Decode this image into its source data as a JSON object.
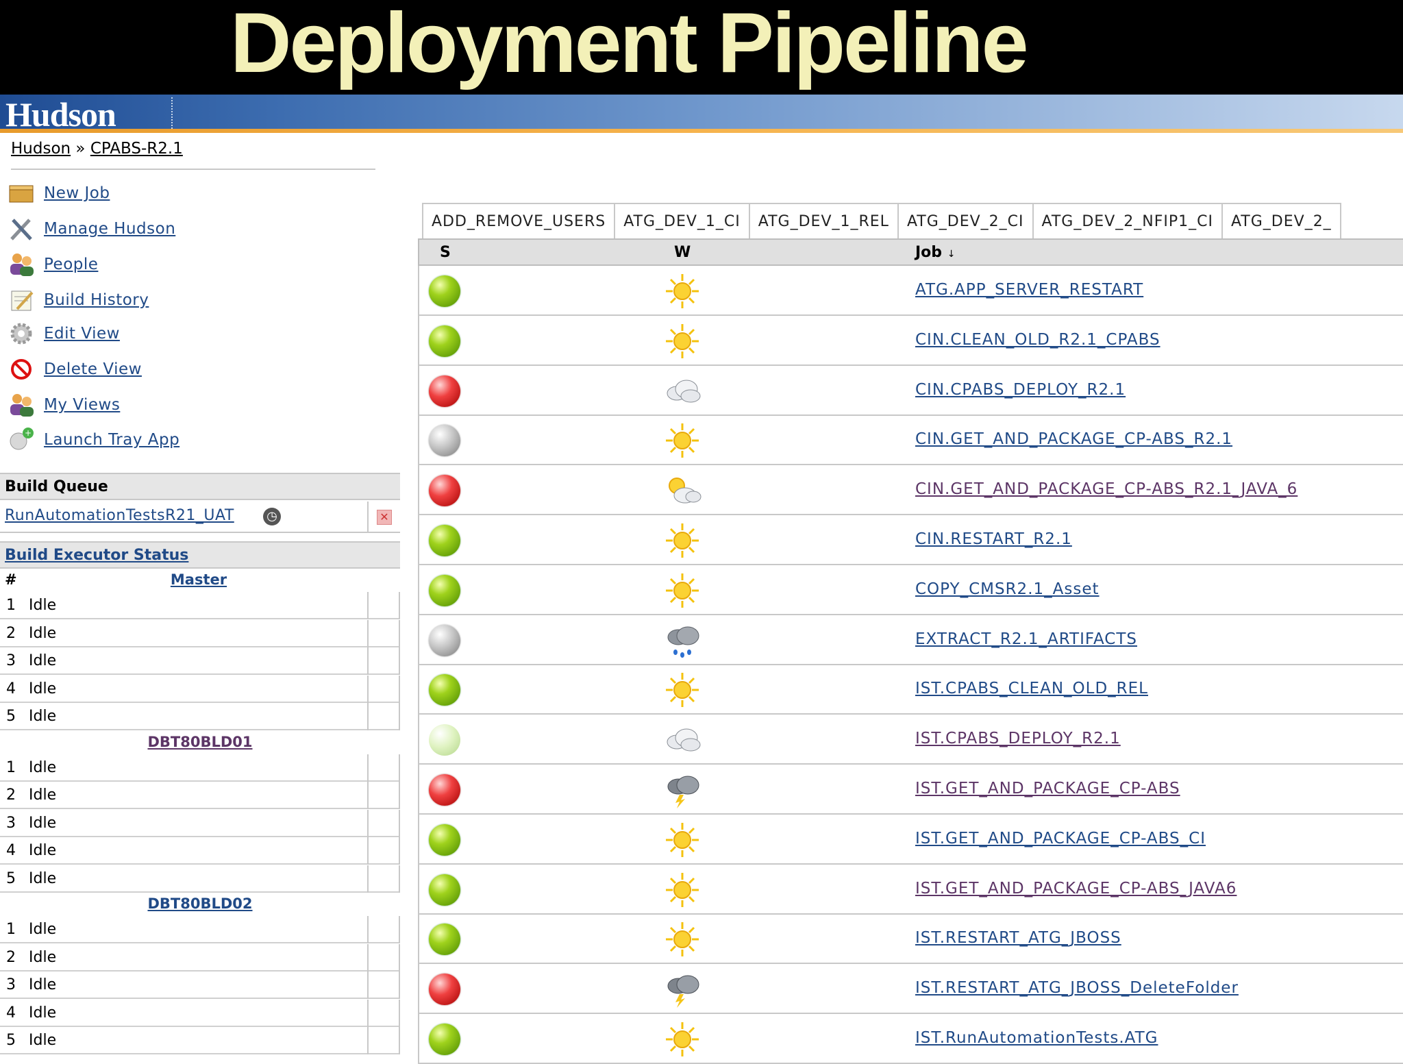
{
  "slide_title": "Deployment Pipeline",
  "app": {
    "logo": "Hudson"
  },
  "breadcrumb": {
    "root": "Hudson",
    "sep": "»",
    "current": "CPABS-R2.1"
  },
  "menu": [
    {
      "label": "New Job",
      "icon": "new-job-icon"
    },
    {
      "label": "Manage Hudson",
      "icon": "tools-icon"
    },
    {
      "label": "People",
      "icon": "people-icon"
    },
    {
      "label": "Build History",
      "icon": "notepad-icon"
    },
    {
      "label": "Edit View",
      "icon": "gear-icon"
    },
    {
      "label": "Delete View",
      "icon": "no-entry-icon"
    },
    {
      "label": "My Views",
      "icon": "people-icon"
    },
    {
      "label": "Launch Tray App",
      "icon": "tray-app-icon"
    }
  ],
  "build_queue": {
    "title": "Build Queue",
    "item": "RunAutomationTestsR21_UAT"
  },
  "executors": {
    "title": "Build Executor Status",
    "hash": "#",
    "nodes": [
      {
        "name": "Master",
        "rows": [
          {
            "n": "1",
            "s": "Idle"
          },
          {
            "n": "2",
            "s": "Idle"
          },
          {
            "n": "3",
            "s": "Idle"
          },
          {
            "n": "4",
            "s": "Idle"
          },
          {
            "n": "5",
            "s": "Idle"
          }
        ]
      },
      {
        "name": "DBT80BLD01",
        "rows": [
          {
            "n": "1",
            "s": "Idle"
          },
          {
            "n": "2",
            "s": "Idle"
          },
          {
            "n": "3",
            "s": "Idle"
          },
          {
            "n": "4",
            "s": "Idle"
          },
          {
            "n": "5",
            "s": "Idle"
          }
        ]
      },
      {
        "name": "DBT80BLD02",
        "rows": [
          {
            "n": "1",
            "s": "Idle"
          },
          {
            "n": "2",
            "s": "Idle"
          },
          {
            "n": "3",
            "s": "Idle"
          },
          {
            "n": "4",
            "s": "Idle"
          },
          {
            "n": "5",
            "s": "Idle"
          }
        ]
      }
    ]
  },
  "tabs": [
    "ADD_REMOVE_USERS",
    "ATG_DEV_1_CI",
    "ATG_DEV_1_REL",
    "ATG_DEV_2_CI",
    "ATG_DEV_2_NFIP1_CI",
    "ATG_DEV_2_"
  ],
  "table": {
    "headers": {
      "s": "S",
      "w": "W",
      "job": "Job",
      "sort": "↓"
    },
    "rows": [
      {
        "status": "green",
        "weather": "sunny",
        "job": "ATG.APP_SERVER_RESTART"
      },
      {
        "status": "green",
        "weather": "sunny",
        "job": "CIN.CLEAN_OLD_R2.1_CPABS"
      },
      {
        "status": "red",
        "weather": "cloudy",
        "job": "CIN.CPABS_DEPLOY_R2.1"
      },
      {
        "status": "grey",
        "weather": "sunny",
        "job": "CIN.GET_AND_PACKAGE_CP-ABS_R2.1"
      },
      {
        "status": "red",
        "weather": "partly-cloudy",
        "job": "CIN.GET_AND_PACKAGE_CP-ABS_R2.1_JAVA_6"
      },
      {
        "status": "green",
        "weather": "sunny",
        "job": "CIN.RESTART_R2.1"
      },
      {
        "status": "green",
        "weather": "sunny",
        "job": "COPY_CMSR2.1_Asset"
      },
      {
        "status": "grey",
        "weather": "rain",
        "job": "EXTRACT_R2.1_ARTIFACTS"
      },
      {
        "status": "green",
        "weather": "sunny",
        "job": "IST.CPABS_CLEAN_OLD_REL"
      },
      {
        "status": "pale",
        "weather": "cloudy",
        "job": "IST.CPABS_DEPLOY_R2.1"
      },
      {
        "status": "red",
        "weather": "storm",
        "job": "IST.GET_AND_PACKAGE_CP-ABS"
      },
      {
        "status": "green",
        "weather": "sunny",
        "job": "IST.GET_AND_PACKAGE_CP-ABS_CI"
      },
      {
        "status": "green",
        "weather": "sunny",
        "job": "IST.GET_AND_PACKAGE_CP-ABS_JAVA6"
      },
      {
        "status": "green",
        "weather": "sunny",
        "job": "IST.RESTART_ATG_JBOSS"
      },
      {
        "status": "red",
        "weather": "storm",
        "job": "IST.RESTART_ATG_JBOSS_DeleteFolder"
      },
      {
        "status": "green",
        "weather": "sunny",
        "job": "IST.RunAutomationTests.ATG"
      }
    ]
  },
  "colors": {
    "link": "#204a87",
    "visited": "#5c3566",
    "title_text": "#f3f0b8"
  }
}
